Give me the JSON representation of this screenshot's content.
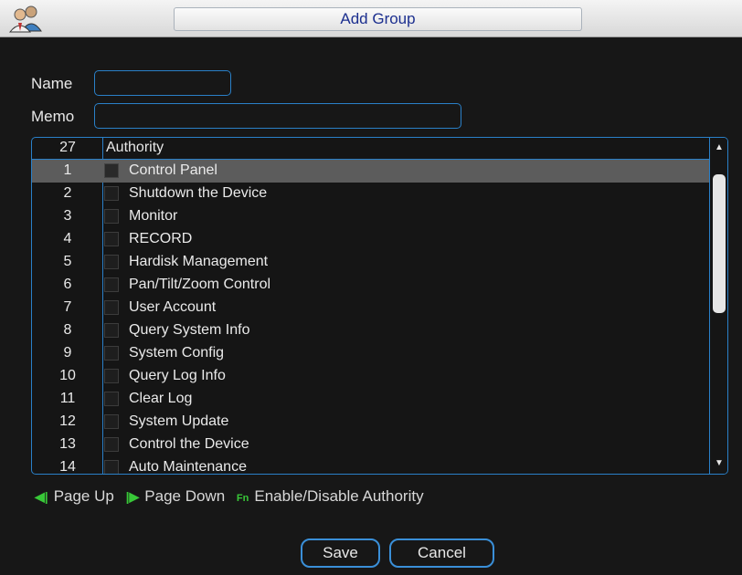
{
  "window": {
    "title": "Add Group"
  },
  "form": {
    "name_label": "Name",
    "name_value": "",
    "memo_label": "Memo",
    "memo_value": ""
  },
  "list": {
    "header_count": "27",
    "header_label": "Authority",
    "rows": [
      {
        "num": "1",
        "label": "Control Panel",
        "selected": true,
        "checked": false
      },
      {
        "num": "2",
        "label": "Shutdown the Device",
        "checked": false
      },
      {
        "num": "3",
        "label": "Monitor",
        "checked": false
      },
      {
        "num": "4",
        "label": "RECORD",
        "checked": false
      },
      {
        "num": "5",
        "label": "Hardisk Management",
        "checked": false
      },
      {
        "num": "6",
        "label": "Pan/Tilt/Zoom Control",
        "checked": false
      },
      {
        "num": "7",
        "label": "User Account",
        "checked": false
      },
      {
        "num": "8",
        "label": "Query System Info",
        "checked": false
      },
      {
        "num": "9",
        "label": "System Config",
        "checked": false
      },
      {
        "num": "10",
        "label": "Query Log Info",
        "checked": false
      },
      {
        "num": "11",
        "label": "Clear Log",
        "checked": false
      },
      {
        "num": "12",
        "label": "System Update",
        "checked": false
      },
      {
        "num": "13",
        "label": "Control the Device",
        "checked": false
      },
      {
        "num": "14",
        "label": "Auto Maintenance",
        "checked": false
      }
    ]
  },
  "hints": {
    "page_up": "Page Up",
    "page_down": "Page Down",
    "fn_icon_text": "Fn",
    "toggle_authority": "Enable/Disable Authority"
  },
  "buttons": {
    "save": "Save",
    "cancel": "Cancel"
  },
  "colors": {
    "accent_border": "#2a80c8",
    "title_text": "#1c2f8f",
    "hint_icon": "#38c838",
    "selected_row": "#5c5c5c"
  },
  "icons": {
    "app": "users-icon",
    "page_up": "page-up-icon",
    "page_down": "page-down-icon",
    "fn": "fn-key-icon"
  }
}
